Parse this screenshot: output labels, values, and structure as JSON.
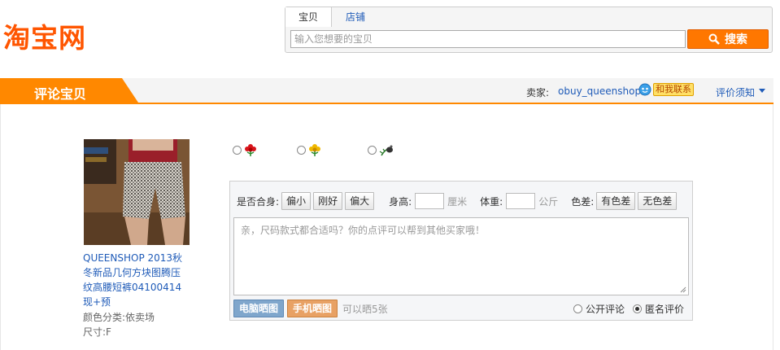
{
  "logo": "淘宝网",
  "search": {
    "tabs": [
      "宝贝",
      "店铺"
    ],
    "placeholder": "输入您想要的宝贝",
    "button": "搜索"
  },
  "bar": {
    "title": "评论宝贝",
    "seller_label": "卖家:",
    "seller_name": "obuy_queenshop",
    "contact": "和我联系",
    "notice": "评价须知"
  },
  "product": {
    "title_lines": [
      "QUEENSHOP 2013秋",
      "冬新品几何方块图腾压",
      "纹高腰短裤04100414",
      "现+预"
    ],
    "color": "颜色分类:依卖场",
    "size": "尺寸:F"
  },
  "ratings": [
    {
      "name": "good",
      "icon": "red-flower-icon"
    },
    {
      "name": "neutral",
      "icon": "yellow-flower-icon"
    },
    {
      "name": "bad",
      "icon": "wilted-flower-icon"
    }
  ],
  "fit": {
    "label": "是否合身:",
    "options": [
      "偏小",
      "刚好",
      "偏大"
    ],
    "height_label": "身高:",
    "height_unit": "厘米",
    "weight_label": "体重:",
    "weight_unit": "公斤",
    "color_label": "色差:",
    "color_options": [
      "有色差",
      "无色差"
    ]
  },
  "review": {
    "placeholder": "亲，尺码款式都合适吗？你的点评可以帮到其他买家哦！"
  },
  "photos": {
    "pc": "电脑晒图",
    "mobile": "手机晒图",
    "hint": "可以晒5张"
  },
  "privacy": {
    "public": "公开评论",
    "anonymous": "匿名评价",
    "selected": "anonymous"
  },
  "colors": {
    "accent": "#ff8800",
    "link": "#1f5bb8"
  }
}
